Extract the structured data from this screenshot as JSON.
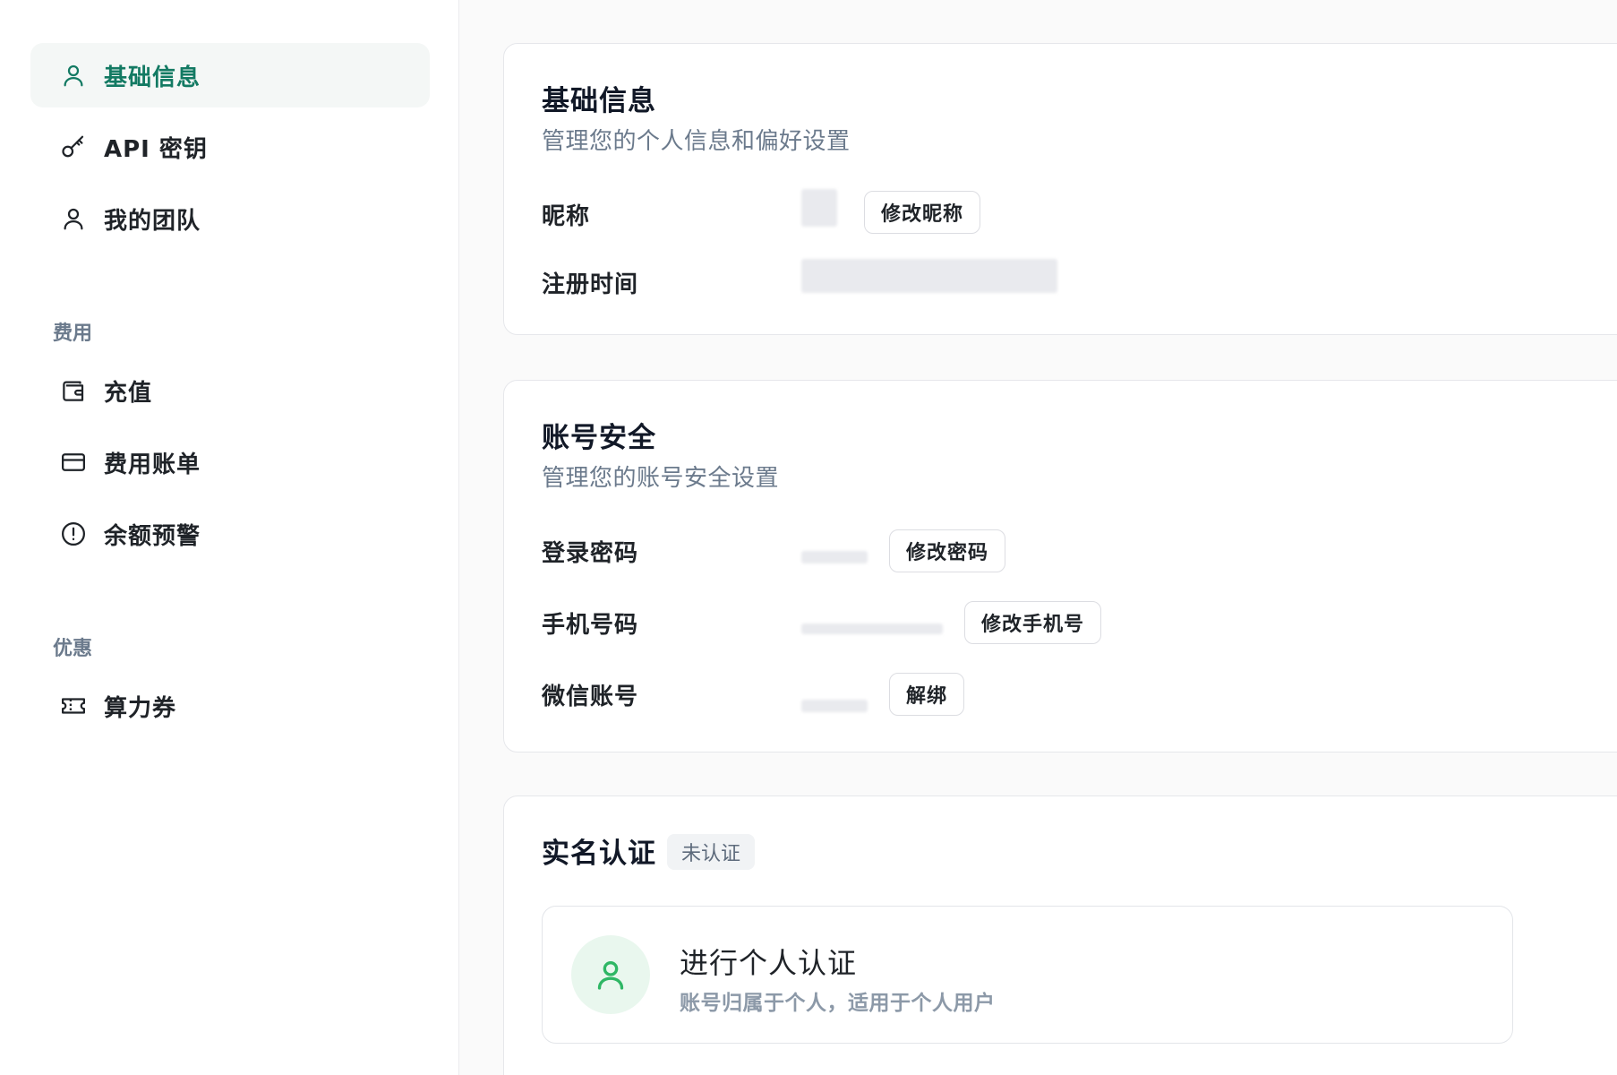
{
  "sidebar": {
    "items_top": [
      {
        "label": "基础信息",
        "icon": "user-icon",
        "active": true
      },
      {
        "label": "API 密钥",
        "icon": "key-icon",
        "active": false
      },
      {
        "label": "我的团队",
        "icon": "user-icon",
        "active": false
      }
    ],
    "section_fees": {
      "label": "费用",
      "items": [
        {
          "label": "充值",
          "icon": "wallet-icon"
        },
        {
          "label": "费用账单",
          "icon": "credit-card-icon"
        },
        {
          "label": "余额预警",
          "icon": "alert-circle-icon"
        }
      ]
    },
    "section_promo": {
      "label": "优惠",
      "items": [
        {
          "label": "算力券",
          "icon": "ticket-icon"
        }
      ]
    }
  },
  "basic_info": {
    "title": "基础信息",
    "subtitle": "管理您的个人信息和偏好设置",
    "nickname_label": "昵称",
    "nickname_button": "修改昵称",
    "register_time_label": "注册时间"
  },
  "account_security": {
    "title": "账号安全",
    "subtitle": "管理您的账号安全设置",
    "password_label": "登录密码",
    "password_button": "修改密码",
    "phone_label": "手机号码",
    "phone_button": "修改手机号",
    "wechat_label": "微信账号",
    "wechat_button": "解绑"
  },
  "real_name": {
    "title": "实名认证",
    "status_badge": "未认证",
    "personal": {
      "title": "进行个人认证",
      "subtitle": "账号归属于个人，适用于个人用户"
    }
  },
  "colors": {
    "accent": "#137a63",
    "accent_bg": "#f4f7f6",
    "muted": "#6b7a8c",
    "success_icon": "#2fb765"
  }
}
